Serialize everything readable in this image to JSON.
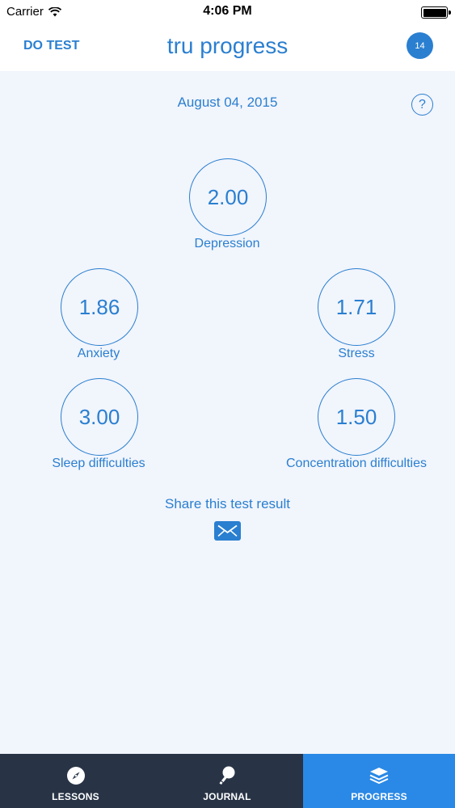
{
  "status_bar": {
    "carrier": "Carrier",
    "time": "4:06 PM"
  },
  "nav": {
    "do_test": "DO TEST",
    "title": "tru progress",
    "badge": "14"
  },
  "date": "August 04, 2015",
  "help": "?",
  "scores": {
    "depression": {
      "value": "2.00",
      "label": "Depression"
    },
    "anxiety": {
      "value": "1.86",
      "label": "Anxiety"
    },
    "stress": {
      "value": "1.71",
      "label": "Stress"
    },
    "sleep": {
      "value": "3.00",
      "label": "Sleep difficulties"
    },
    "concentration": {
      "value": "1.50",
      "label": "Concentration difficulties"
    }
  },
  "share": {
    "label": "Share this test result",
    "icon": "mail-icon"
  },
  "tabs": [
    {
      "label": "LESSONS",
      "icon": "compass-icon",
      "active": false
    },
    {
      "label": "JOURNAL",
      "icon": "lightbulb-icon",
      "active": false
    },
    {
      "label": "PROGRESS",
      "icon": "layers-icon",
      "active": true
    }
  ],
  "colors": {
    "accent": "#2a7fd0",
    "background": "#f1f5fc",
    "tab_bar": "#283446",
    "tab_active": "#2a89e6"
  }
}
